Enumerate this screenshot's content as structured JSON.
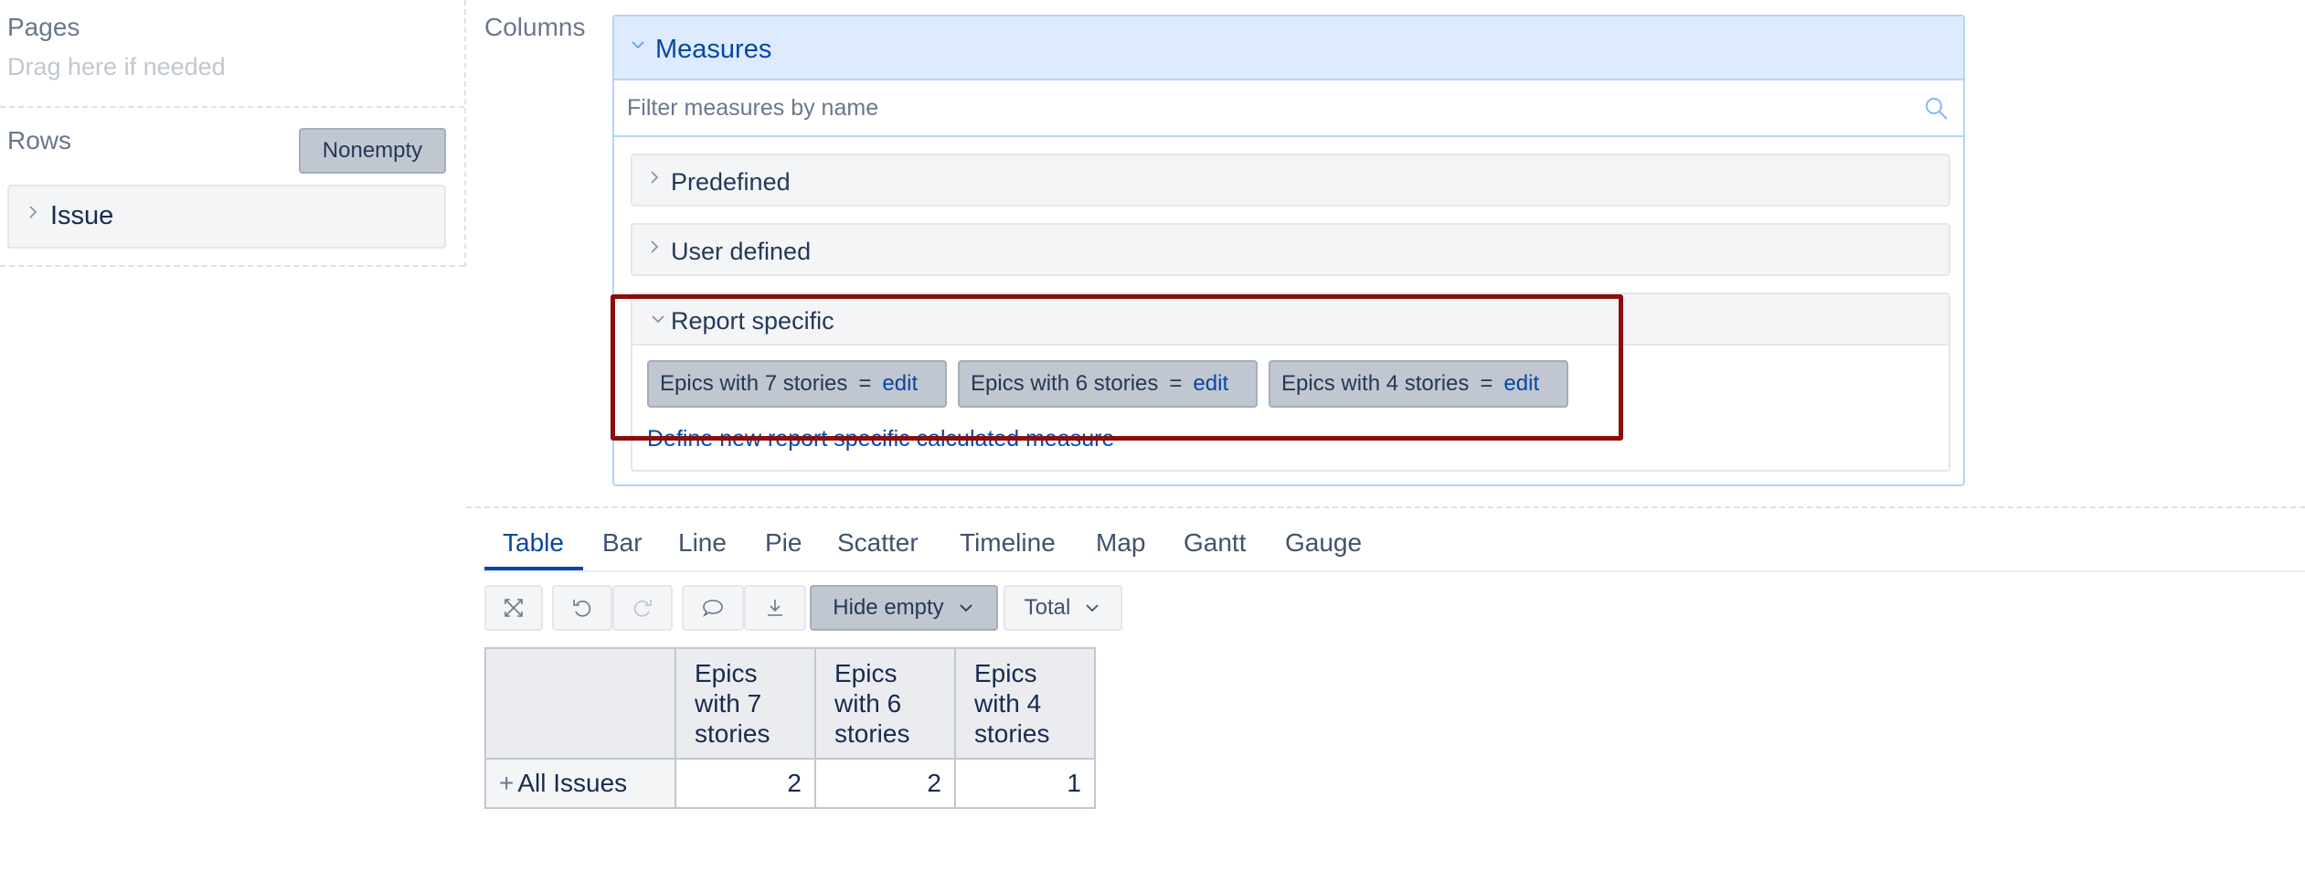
{
  "left": {
    "pages": {
      "title": "Pages",
      "hint": "Drag here if needed"
    },
    "rows": {
      "title": "Rows",
      "nonempty_label": "Nonempty",
      "dimension": "Issue"
    }
  },
  "columns": {
    "title": "Columns",
    "measures": {
      "title": "Measures",
      "filter_placeholder": "Filter measures by name",
      "folders": {
        "predefined": "Predefined",
        "user_defined": "User defined",
        "report_specific": "Report specific"
      },
      "report_specific_items": [
        {
          "name": "Epics with 7 stories",
          "eq": "=",
          "edit": "edit"
        },
        {
          "name": "Epics with 6 stories",
          "eq": "=",
          "edit": "edit"
        },
        {
          "name": "Epics with 4 stories",
          "eq": "=",
          "edit": "edit"
        }
      ],
      "define_new_link": "Define new report specific calculated measure"
    }
  },
  "view_tabs": [
    "Table",
    "Bar",
    "Line",
    "Pie",
    "Scatter",
    "Timeline",
    "Map",
    "Gantt",
    "Gauge"
  ],
  "active_tab": "Table",
  "toolbar": {
    "icons": [
      "expand-icon",
      "undo-icon",
      "redo-icon",
      "comment-icon",
      "download-icon"
    ],
    "hide_empty_label": "Hide empty",
    "total_label": "Total"
  },
  "table": {
    "headers": [
      "Epics with 7 stories",
      "Epics with 6 stories",
      "Epics with 4 stories"
    ],
    "header_lines": [
      [
        "Epics",
        "with 7",
        "stories"
      ],
      [
        "Epics",
        "with 6",
        "stories"
      ],
      [
        "Epics",
        "with 4",
        "stories"
      ]
    ],
    "rows": [
      {
        "label": "All Issues",
        "expand": "+",
        "values": [
          "2",
          "2",
          "1"
        ]
      }
    ]
  },
  "colors": {
    "accent": "#0747a6",
    "highlight_border": "#8b0d0d",
    "header_bg": "#deebff"
  }
}
